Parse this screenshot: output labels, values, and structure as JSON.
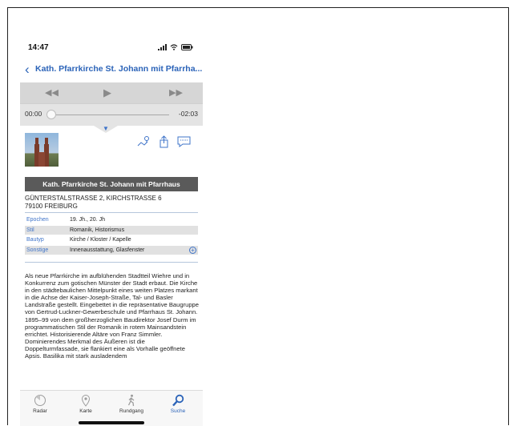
{
  "status": {
    "time": "14:47"
  },
  "nav": {
    "title": "Kath. Pfarrkirche St. Johann mit Pfarrha..."
  },
  "player": {
    "current": "00:00",
    "remaining": "-02:03",
    "progress_fraction": 0.0
  },
  "object": {
    "title": "Kath. Pfarrkirche St. Johann mit Pfarrhaus",
    "address_line1": "GÜNTERSTALSTRASSE 2, KIRCHSTRASSE 6",
    "address_line2": "79100 FREIBURG"
  },
  "attributes": [
    {
      "key": "Epochen",
      "value": "19. Jh., 20. Jh"
    },
    {
      "key": "Stil",
      "value": "Romanik, Historismus"
    },
    {
      "key": "Bautyp",
      "value": "Kirche / Kloster / Kapelle"
    },
    {
      "key": "Sonstige",
      "value": "Innenausstattung, Glasfenster"
    }
  ],
  "description": "Als neue Pfarrkirche im aufblühenden Stadtteil Wiehre und in Konkurrenz zum gotischen Münster der Stadt erbaut. Die Kirche in den städtebaulichen Mittelpunkt eines weiten Platzes markant in die Achse der Kaiser-Joseph-Straße, Tal- und Basler Landstraße gestellt. Eingebettet in die repräsentative Baugruppe von Gertrud-Luckner-Gewerbeschule und Pfarrhaus St. Johann. 1895–99 von dem großherzoglichen Baudirektor Josef Durm im programmatischen Stil der Romanik in rotem Mainsandstein errichtet. Historisierende Altäre von Franz Simmler. Dominierendes Merkmal des Äußeren ist die Doppelturmfassade, sie flankiert eine als Vorhalle geöffnete Apsis. Basilika mit stark ausladendem",
  "tabs": [
    {
      "label": "Radar",
      "icon": "radar-icon"
    },
    {
      "label": "Karte",
      "icon": "map-pin-icon"
    },
    {
      "label": "Rundgang",
      "icon": "walking-person-icon"
    },
    {
      "label": "Suche",
      "icon": "search-icon"
    }
  ],
  "colors": {
    "accent": "#2b63b8",
    "header_band": "#5a5a5a"
  }
}
